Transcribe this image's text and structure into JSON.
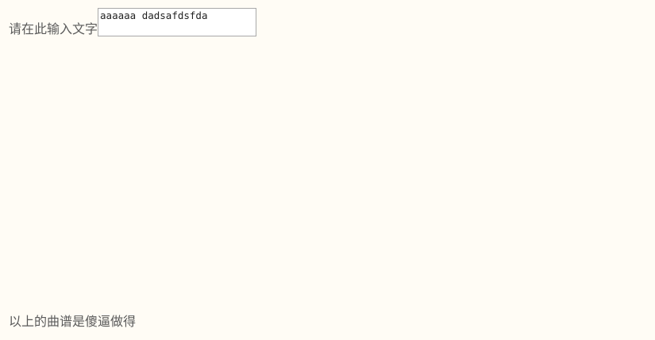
{
  "form": {
    "label": "请在此输入文字",
    "input_value": "aaaaaa dadsafdsfda"
  },
  "footer": {
    "note": "以上的曲谱是傻逼做得"
  }
}
